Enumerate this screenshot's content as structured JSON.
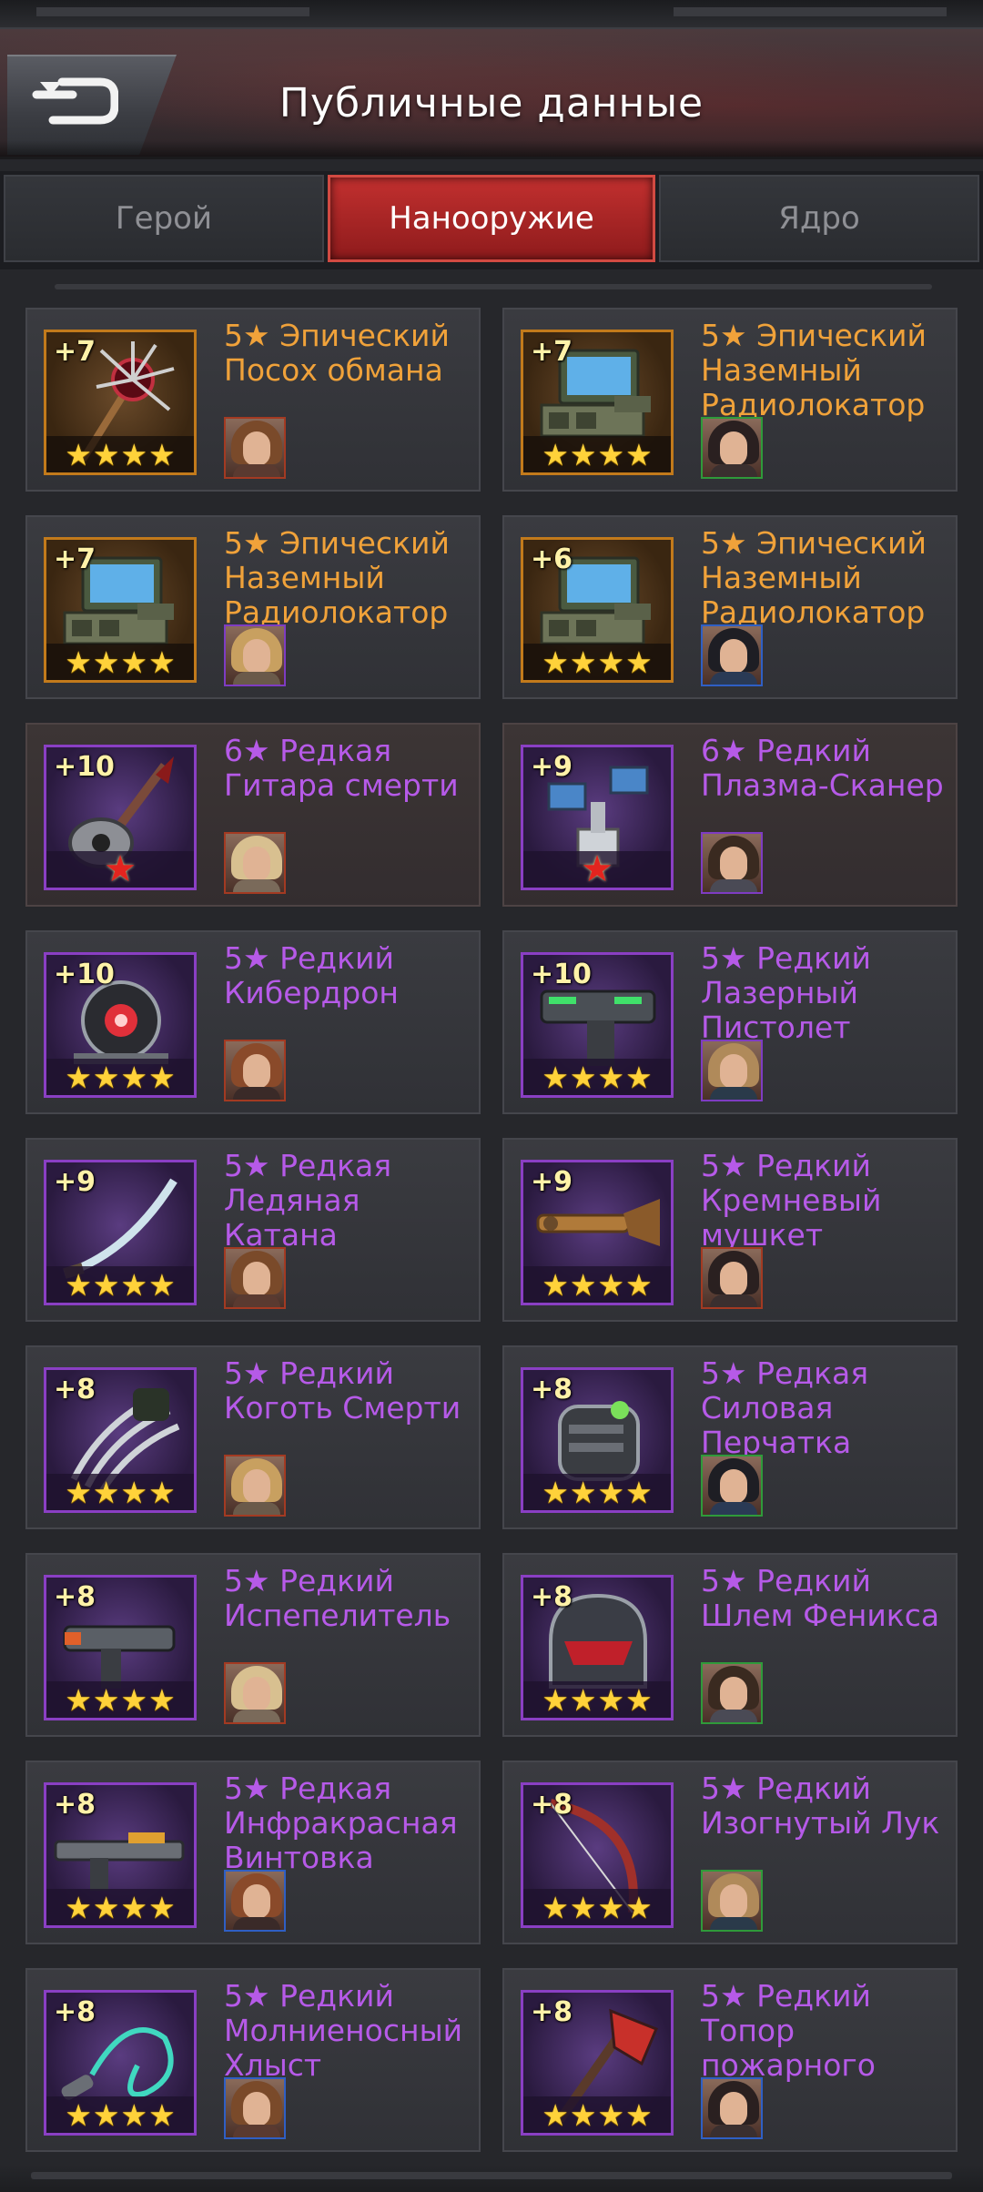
{
  "header": {
    "title": "Публичные данные"
  },
  "tabs": [
    {
      "label": "Герой",
      "active": false
    },
    {
      "label": "Нанооружие",
      "active": true
    },
    {
      "label": "Ядро",
      "active": false
    }
  ],
  "colors": {
    "epic": "#f0a23a",
    "rare": "#b65ae8",
    "tab_active": "#b32828",
    "star": "#ffd23a"
  },
  "items": [
    {
      "level": "+7",
      "name": "5★ Эпический\nПосох обмана",
      "rarity": "epic",
      "stars": 4,
      "icon": "spiked-staff-icon",
      "avatar_border": "red"
    },
    {
      "level": "+7",
      "name": "5★ Эпический\nНаземный\nРадиолокатор",
      "rarity": "epic",
      "stars": 4,
      "icon": "radar-icon",
      "avatar_border": "green"
    },
    {
      "level": "+7",
      "name": "5★ Эпический\nНаземный\nРадиолокатор",
      "rarity": "epic",
      "stars": 4,
      "icon": "radar-icon",
      "avatar_border": "purple"
    },
    {
      "level": "+6",
      "name": "5★ Эпический\nНаземный\nРадиолокатор",
      "rarity": "epic",
      "stars": 4,
      "icon": "radar-icon",
      "avatar_border": "blue"
    },
    {
      "level": "+10",
      "name": "6★ Редкая\nГитара смерти",
      "rarity": "rare-6",
      "stars": 1,
      "icon": "guitar-icon",
      "avatar_border": "red"
    },
    {
      "level": "+9",
      "name": "6★ Редкий\nПлазма-Сканер",
      "rarity": "rare-6",
      "stars": 1,
      "icon": "scanner-icon",
      "avatar_border": "purple"
    },
    {
      "level": "+10",
      "name": "5★ Редкий\nКибердрон",
      "rarity": "rare",
      "stars": 4,
      "icon": "drone-icon",
      "avatar_border": "red"
    },
    {
      "level": "+10",
      "name": "5★ Редкий\nЛазерный\nПистолет",
      "rarity": "rare",
      "stars": 4,
      "icon": "laser-pistol-icon",
      "avatar_border": "purple"
    },
    {
      "level": "+9",
      "name": "5★ Редкая\nЛедяная\nКатана",
      "rarity": "rare",
      "stars": 4,
      "icon": "katana-icon",
      "avatar_border": "red"
    },
    {
      "level": "+9",
      "name": "5★ Редкий\nКремневый\nмушкет",
      "rarity": "rare",
      "stars": 4,
      "icon": "musket-icon",
      "avatar_border": "red"
    },
    {
      "level": "+8",
      "name": "5★ Редкий\nКоготь Смерти",
      "rarity": "rare",
      "stars": 4,
      "icon": "claw-icon",
      "avatar_border": "red"
    },
    {
      "level": "+8",
      "name": "5★ Редкая\nСиловая\nПерчатка",
      "rarity": "rare",
      "stars": 4,
      "icon": "power-glove-icon",
      "avatar_border": "green"
    },
    {
      "level": "+8",
      "name": "5★ Редкий\nИспепелитель",
      "rarity": "rare",
      "stars": 4,
      "icon": "incinerator-icon",
      "avatar_border": "red"
    },
    {
      "level": "+8",
      "name": "5★ Редкий\nШлем Феникса",
      "rarity": "rare",
      "stars": 4,
      "icon": "helmet-icon",
      "avatar_border": "green"
    },
    {
      "level": "+8",
      "name": "5★ Редкая\nИнфракрасная\nВинтовка",
      "rarity": "rare",
      "stars": 4,
      "icon": "rifle-icon",
      "avatar_border": "blue"
    },
    {
      "level": "+8",
      "name": "5★ Редкий\nИзогнутый Лук",
      "rarity": "rare",
      "stars": 4,
      "icon": "bow-icon",
      "avatar_border": "green"
    },
    {
      "level": "+8",
      "name": "5★ Редкий\nМолниеносный\nХлыст",
      "rarity": "rare",
      "stars": 4,
      "icon": "whip-icon",
      "avatar_border": "blue"
    },
    {
      "level": "+8",
      "name": "5★ Редкий\nТопор\nпожарного",
      "rarity": "rare",
      "stars": 4,
      "icon": "fire-axe-icon",
      "avatar_border": "blue"
    }
  ]
}
